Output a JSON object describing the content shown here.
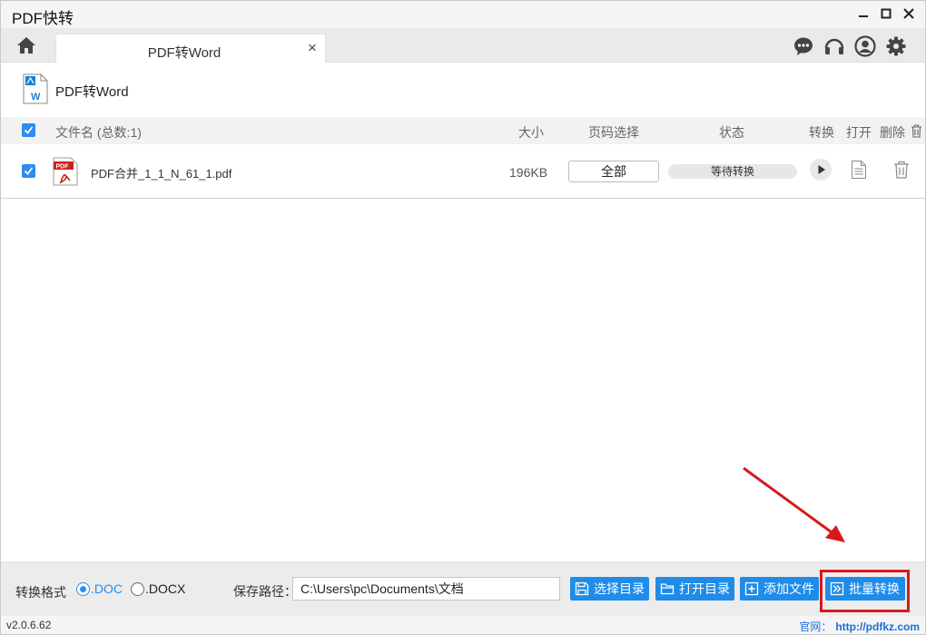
{
  "app": {
    "title": "PDF快转"
  },
  "tabs": [
    {
      "label": "PDF转Word",
      "close": "×"
    }
  ],
  "section": {
    "title": "PDF转Word"
  },
  "table": {
    "headers": {
      "filename": "文件名 (总数:1)",
      "size": "大小",
      "page_select": "页码选择",
      "status": "状态",
      "convert": "转换",
      "open": "打开",
      "delete": "删除"
    },
    "rows": [
      {
        "checked": true,
        "filename": "PDF合并_1_1_N_61_1.pdf",
        "size": "196KB",
        "page_select": "全部",
        "status": "等待转换"
      }
    ]
  },
  "bottom": {
    "format_label": "转换格式",
    "formats": [
      {
        "label": ".DOC",
        "selected": true
      },
      {
        "label": ".DOCX",
        "selected": false
      }
    ],
    "path_label": "保存路径：",
    "path_value": "C:\\Users\\pc\\Documents\\文档",
    "buttons": {
      "choose_dir": "选择目录",
      "open_dir": "打开目录",
      "add_file": "添加文件",
      "batch_convert": "批量转换"
    }
  },
  "statusbar": {
    "version": "v2.0.6.62",
    "site_label": "官网：",
    "site_url": "http://pdfkz.com"
  },
  "colors": {
    "accent": "#1e8ce8",
    "checkbox": "#2a8df0",
    "highlight": "#d61a1a",
    "link": "#1a6fd6"
  },
  "icons": [
    "home-icon",
    "chat-icon",
    "headset-icon",
    "user-icon",
    "gear-icon",
    "minimize-icon",
    "maximize-icon",
    "close-icon",
    "word-doc-icon",
    "pdf-file-icon",
    "play-icon",
    "open-file-icon",
    "trash-icon",
    "save-icon",
    "folder-icon",
    "plus-icon",
    "batch-icon"
  ]
}
